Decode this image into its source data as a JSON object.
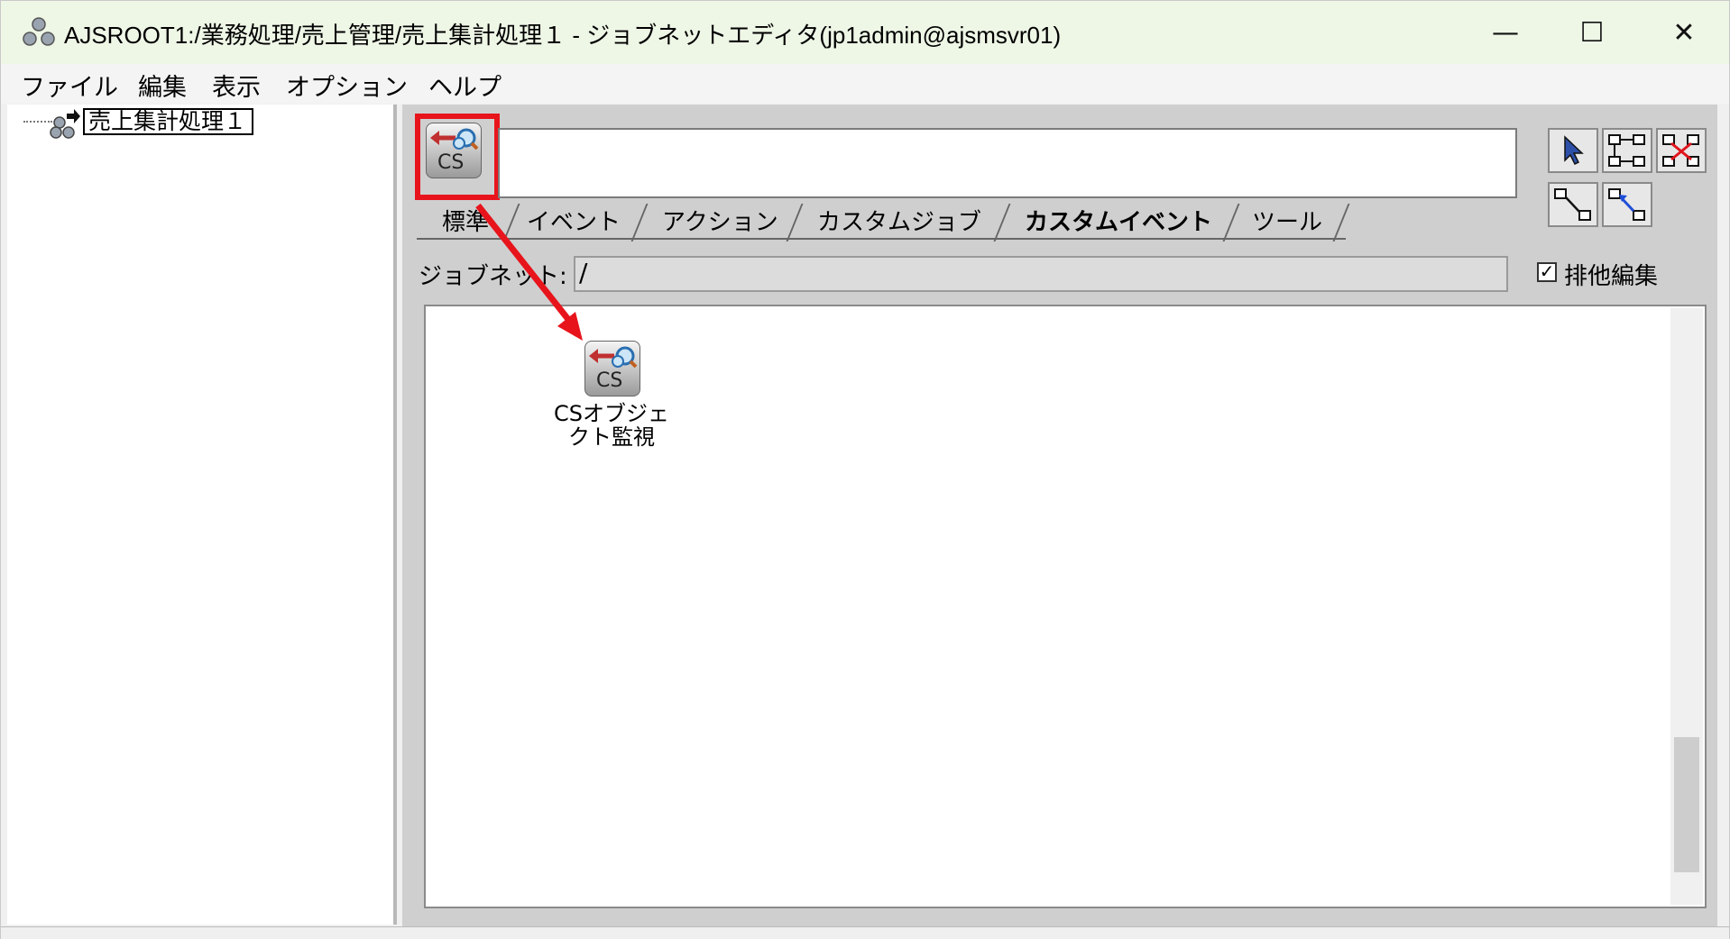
{
  "window": {
    "title": "AJSROOT1:/業務処理/売上管理/売上集計処理１ - ジョブネットエディタ(jp1admin@ajsmsvr01)",
    "controls": {
      "minimize": "—",
      "maximize": "☐",
      "close": "✕"
    }
  },
  "menu": [
    "ファイル",
    "編集",
    "表示",
    "オプション",
    "ヘルプ"
  ],
  "tree": {
    "root_label": "売上集計処理１"
  },
  "tabs": [
    "標準",
    "イベント",
    "アクション",
    "カスタムジョブ",
    "カスタムイベント",
    "ツール"
  ],
  "active_tab": "カスタムイベント",
  "jobnet": {
    "label": "ジョブネット:",
    "value": "/"
  },
  "exclusive_edit": {
    "label": "排他編集",
    "checked": true
  },
  "palette_icon": {
    "name": "cs-object-monitor-icon",
    "text": "CS"
  },
  "node": {
    "label_line1": "CSオブジェ",
    "label_line2": "クト監視",
    "icon_text": "CS"
  },
  "colors": {
    "highlight": "#e8141c",
    "titlebar_bg": "#eef6e6",
    "panel_bg": "#cfcfcf"
  }
}
